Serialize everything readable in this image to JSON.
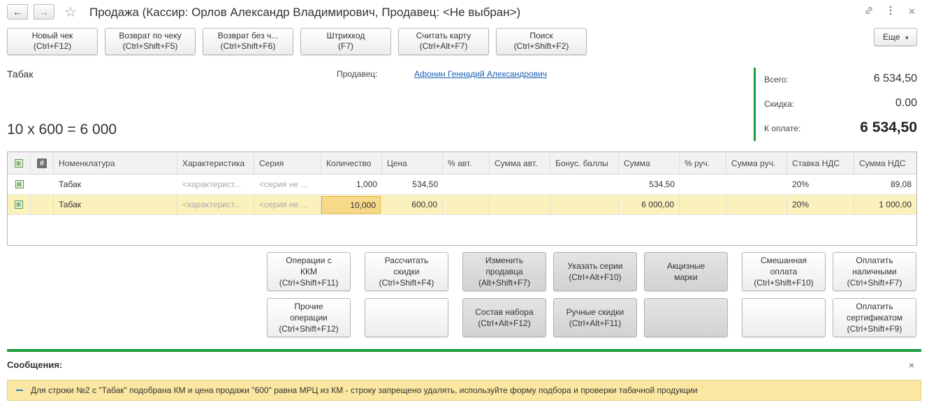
{
  "window": {
    "title": "Продажа (Кассир: Орлов Александр Владимирович, Продавец: <Не выбран>)",
    "back_icon": "arrow-left-icon",
    "forward_icon": "arrow-right-icon",
    "link_icon": "link-icon",
    "menu_icon": "more-vertical-icon",
    "close_icon": "close-icon"
  },
  "toolbar": {
    "buttons": [
      {
        "line1": "Новый чек",
        "line2": "(Ctrl+F12)"
      },
      {
        "line1": "Возврат по чеку",
        "line2": "(Ctrl+Shift+F5)"
      },
      {
        "line1": "Возврат без ч...",
        "line2": "(Ctrl+Shift+F6)"
      },
      {
        "line1": "Штрихкод",
        "line2": "(F7)"
      },
      {
        "line1": "Считать карту",
        "line2": "(Ctrl+Alt+F7)"
      },
      {
        "line1": "Поиск",
        "line2": "(Ctrl+Shift+F2)"
      }
    ],
    "more_label": "Еще"
  },
  "info": {
    "product_name": "Табак",
    "seller_label": "Продавец:",
    "seller_name": "Афонин Геннадий Александрович",
    "calc_line": "10 x 600 = 6 000"
  },
  "totals": {
    "total_label": "Всего:",
    "total_value": "6 534,50",
    "discount_label": "Скидка:",
    "discount_value": "0.00",
    "pay_label": "К оплате:",
    "pay_value": "6 534,50"
  },
  "table": {
    "headers": [
      "Номенклатура",
      "Характеристика",
      "Серия",
      "Количество",
      "Цена",
      "% авт.",
      "Сумма авт.",
      "Бонус. баллы",
      "Сумма",
      "% руч.",
      "Сумма руч.",
      "Ставка НДС",
      "Сумма НДС"
    ],
    "hash_header": "#",
    "rows": [
      {
        "name": "Табак",
        "char": "<характерист...",
        "series": "<серия не ...",
        "qty": "1,000",
        "price": "534,50",
        "auto_pct": "",
        "auto_sum": "",
        "bonus": "",
        "sum": "534,50",
        "man_pct": "",
        "man_sum": "",
        "vat_rate": "20%",
        "vat_sum": "89,08"
      },
      {
        "name": "Табак",
        "char": "<характерист...",
        "series": "<серия не ...",
        "qty": "10,000",
        "price": "600,00",
        "auto_pct": "",
        "auto_sum": "",
        "bonus": "",
        "sum": "6 000,00",
        "man_pct": "",
        "man_sum": "",
        "vat_rate": "20%",
        "vat_sum": "1 000,00"
      }
    ]
  },
  "actions": {
    "kkm_ops": "Операции с\nККМ\n(Ctrl+Shift+F11)",
    "calc_discounts": "Рассчитать\nскидки\n(Ctrl+Shift+F4)",
    "change_seller": "Изменить\nпродавца\n(Alt+Shift+F7)",
    "set_series": "Указать серии\n(Ctrl+Alt+F10)",
    "excise_marks": "Акцизные\nмарки",
    "mixed_pay": "Смешанная\nоплата\n(Ctrl+Shift+F10)",
    "pay_cash": "Оплатить\nналичными\n(Ctrl+Shift+F7)",
    "other_ops": "Прочие\nоперации\n(Ctrl+Shift+F12)",
    "kit_content": "Состав набора\n(Ctrl+Alt+F12)",
    "manual_discounts": "Ручные скидки\n(Ctrl+Alt+F11)",
    "pay_cert": "Оплатить\nсертификатом\n(Ctrl+Shift+F9)"
  },
  "messages": {
    "title": "Сообщения:",
    "text": "Для строки №2 с \"Табак\" подобрана КМ и цена продажи \"600\" равна МРЦ из КМ - строку запрещено удалять, используйте форму подбора и проверки табачной продукции"
  }
}
